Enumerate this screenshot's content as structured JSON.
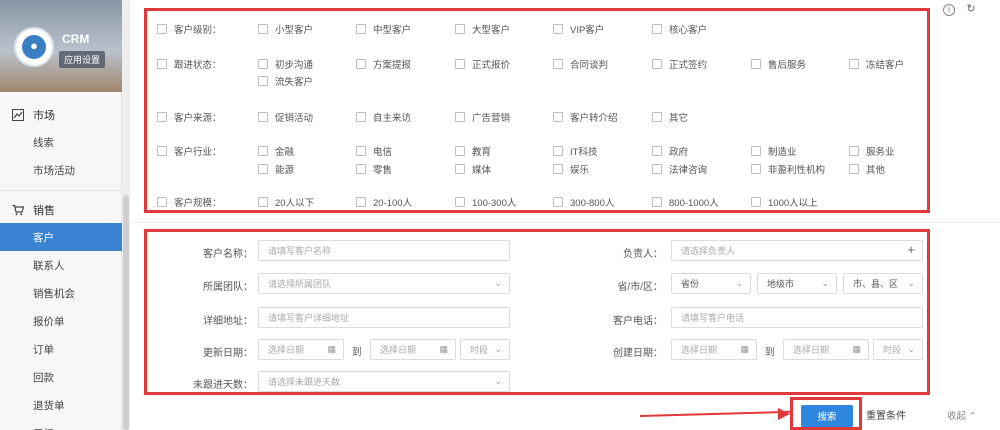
{
  "app": {
    "name": "CRM",
    "badge": "应用设置"
  },
  "sidebar": {
    "groups": [
      {
        "label": "市场",
        "icon": "chart-icon",
        "items": [
          "线索",
          "市场活动"
        ]
      },
      {
        "label": "销售",
        "icon": "cart-icon",
        "items": [
          "客户",
          "联系人",
          "销售机会",
          "报价单",
          "订单",
          "回款",
          "退货单",
          "目标"
        ]
      }
    ],
    "active_item": "客户"
  },
  "filters": {
    "level": {
      "label": "客户级别：",
      "options": [
        "小型客户",
        "中型客户",
        "大型客户",
        "VIP客户",
        "核心客户"
      ]
    },
    "status": {
      "label": "跟进状态：",
      "options": [
        "初步沟通",
        "方案提报",
        "正式报价",
        "合同谈判",
        "正式签约",
        "售后服务",
        "冻结客户",
        "流失客户"
      ]
    },
    "source": {
      "label": "客户来源：",
      "options": [
        "促销活动",
        "自主来访",
        "广告营销",
        "客户转介绍",
        "其它"
      ]
    },
    "industry": {
      "label": "客户行业：",
      "options": [
        "金融",
        "电信",
        "教育",
        "IT科技",
        "政府",
        "制造业",
        "服务业",
        "能源",
        "零售",
        "媒体",
        "娱乐",
        "法律咨询",
        "非盈利性机构",
        "其他"
      ]
    },
    "scale": {
      "label": "客户规模：",
      "options": [
        "20人以下",
        "20-100人",
        "100-300人",
        "300-800人",
        "800-1000人",
        "1000人以上"
      ]
    }
  },
  "form": {
    "customer_name": {
      "label": "客户名称：",
      "placeholder": "请填写客户名称"
    },
    "owner": {
      "label": "负责人：",
      "placeholder": "请选择负责人"
    },
    "team": {
      "label": "所属团队：",
      "placeholder": "请选择所属团队"
    },
    "region": {
      "label": "省/市/区：",
      "province": "省份",
      "city": "地级市",
      "district": "市、县、区"
    },
    "address": {
      "label": "详细地址：",
      "placeholder": "请填写客户详细地址"
    },
    "phone": {
      "label": "客户电话：",
      "placeholder": "请填写客户电话"
    },
    "updated": {
      "label": "更新日期：",
      "start": "选择日期",
      "to": "到",
      "end": "选择日期",
      "period": "时段"
    },
    "created": {
      "label": "创建日期：",
      "start": "选择日期",
      "to": "到",
      "end": "选择日期",
      "period": "时段"
    },
    "days_no_followup": {
      "label": "未跟进天数：",
      "placeholder": "请选择未跟进天数"
    }
  },
  "actions": {
    "search": "搜索",
    "reset": "重置条件",
    "collapse": "收起"
  },
  "colors": {
    "accent": "#2e86de",
    "highlight": "#e0393b",
    "active_nav": "#3b84d4"
  }
}
